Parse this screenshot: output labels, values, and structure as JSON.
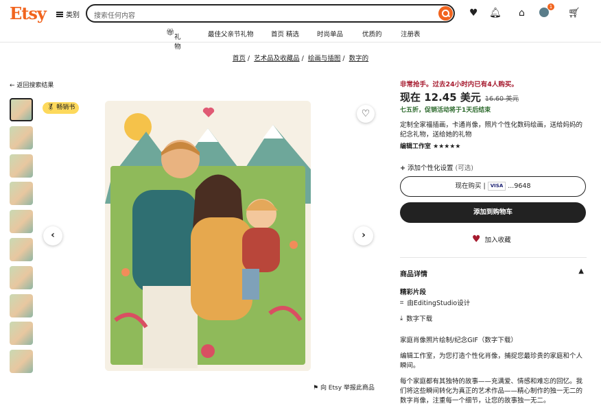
{
  "header": {
    "logo": "Etsy",
    "categories_label": "类别",
    "search_placeholder": "搜索任何内容",
    "notification_count": "1"
  },
  "nav": {
    "items": [
      "礼物",
      "最佳父亲节礼物",
      "首页 精选",
      "时尚单品",
      "优质的",
      "注册表"
    ]
  },
  "breadcrumb": [
    "首页",
    "艺术品及收藏品",
    "绘画与插图",
    "数字的"
  ],
  "back_link": "返回搜索结果",
  "bestseller_badge": "畅销书",
  "report_link": "向 Etsy 举报此商品",
  "product": {
    "urgency": "非常抢手。过去24小时内已有4人购买。",
    "price_now": "现在 12.45 美元",
    "price_old": "16.60 美元",
    "sale_note": "七五折，促销活动将于1天后结束",
    "title": "定制全家福插画，卡通肖像，照片个性化数码绘画，送给妈妈的纪念礼物，送给她的礼物",
    "shop": "编辑工作室 ★★★★★",
    "personalization": "添加个性化设置",
    "personalization_note": "(可选)",
    "buy_now": "现在购买 |",
    "card_brand": "VISA",
    "card_last": "...9648",
    "add_to_cart": "添加到购物车",
    "add_to_collection": "加入收藏"
  },
  "details": {
    "heading": "商品详情",
    "highlights": "精彩片段",
    "designed_by": "由EditingStudio设计",
    "download": "数字下载",
    "line1": "家庭肖像照片绘制/纪念GIF（数字下载）",
    "line2": "编辑工作室，为您打造个性化肖像，捕捉您最珍贵的家庭和个人瞬间。",
    "line3": "每个家庭都有其独特的故事——充满爱、情感和难忘的回忆。我们将这些瞬间转化为真正的艺术作品——精心制作的独一无二的数字肖像，注重每一个细节，让您的故事独一无二。"
  },
  "colors": {
    "brand": "#f1641e",
    "urgency": "#a61a2e",
    "sale": "#2e6b2e"
  }
}
